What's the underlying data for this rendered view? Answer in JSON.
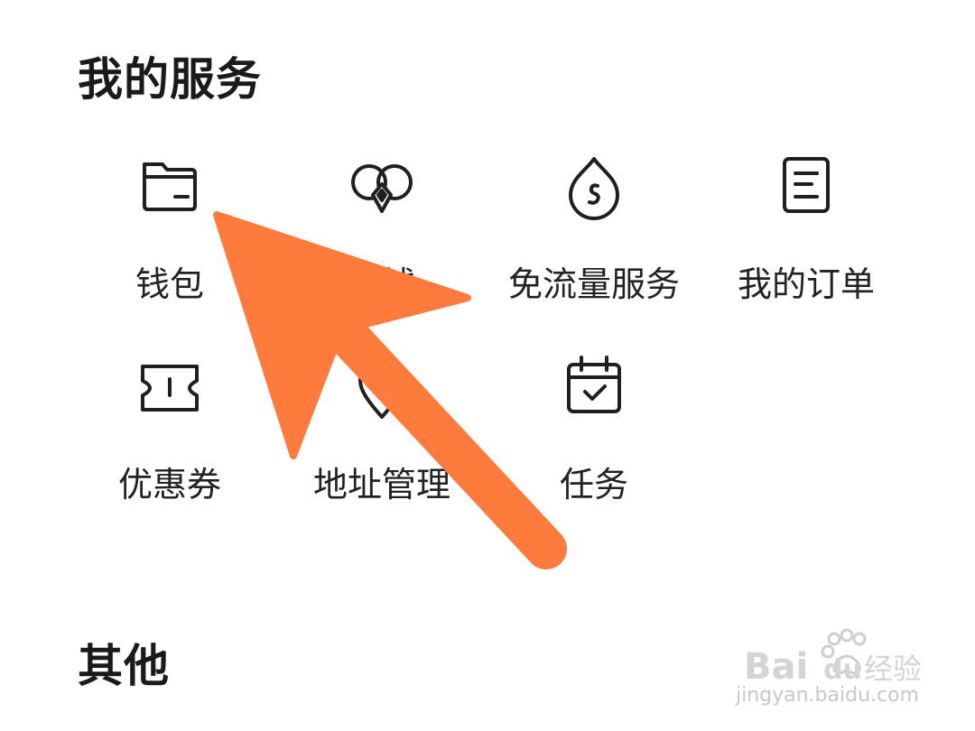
{
  "sections": {
    "services_title": "我的服务",
    "other_title": "其他"
  },
  "services": [
    {
      "label": "钱包",
      "icon": "wallet-icon"
    },
    {
      "label": "借钱",
      "icon": "loan-icon"
    },
    {
      "label": "免流量服务",
      "icon": "free-data-icon"
    },
    {
      "label": "我的订单",
      "icon": "order-icon"
    },
    {
      "label": "优惠券",
      "icon": "coupon-icon"
    },
    {
      "label": "地址管理",
      "icon": "location-pin-icon"
    },
    {
      "label": "任务",
      "icon": "task-calendar-icon"
    }
  ],
  "annotation": {
    "arrow_color": "#ff7a3d",
    "points_to": "钱包"
  },
  "watermark": {
    "brand": "Bai du 经验",
    "url": "jingyan.baidu.com"
  }
}
